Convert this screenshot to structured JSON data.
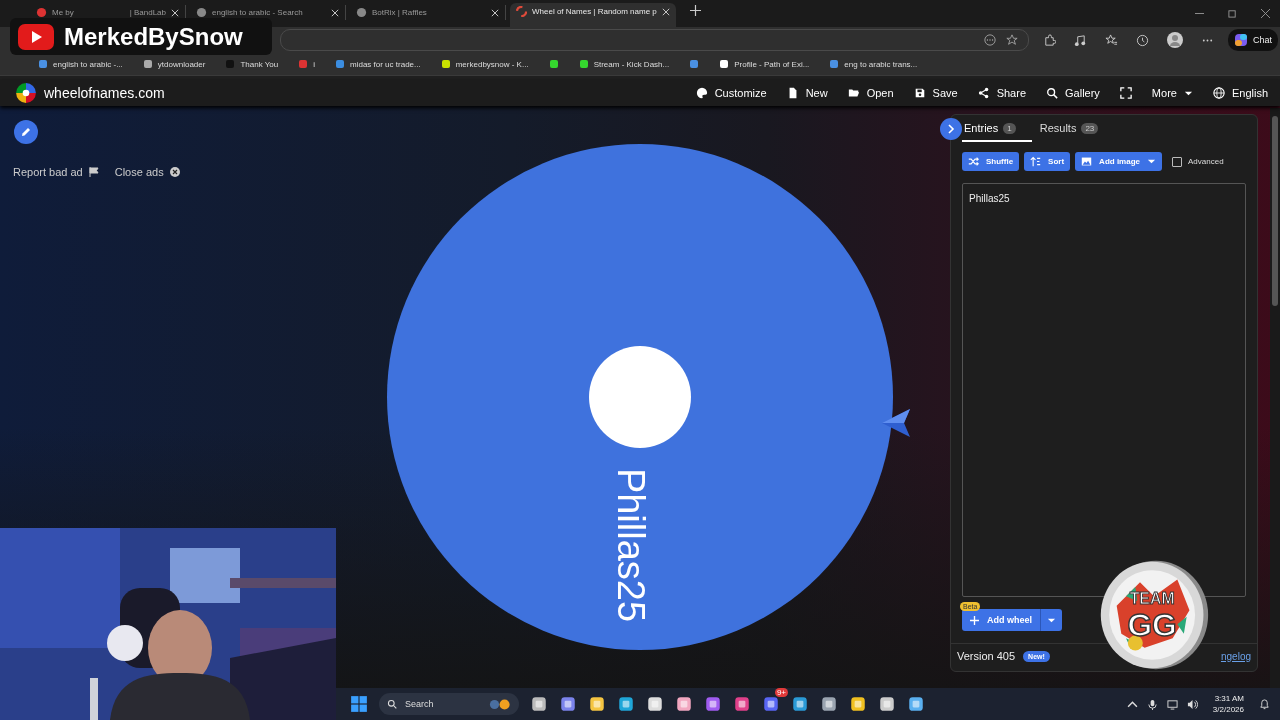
{
  "stream_overlay": {
    "channel": "MerkedBySnow"
  },
  "browser": {
    "tabs": [
      {
        "title": "Me by",
        "title_end": "| BandLab",
        "selected": false
      },
      {
        "title": "english to arabic - Search",
        "selected": false
      },
      {
        "title": "BotRix | Raffles",
        "selected": false
      },
      {
        "title": "Wheel of Names | Random name p",
        "selected": true
      }
    ],
    "bookmarks": [
      {
        "kind": "link",
        "label": "english to arabic -..."
      },
      {
        "kind": "link",
        "label": "ytdownloader"
      },
      {
        "kind": "link",
        "label": "Thank You"
      },
      {
        "kind": "link",
        "label": "i"
      },
      {
        "kind": "link",
        "label": "midas for uc trade..."
      },
      {
        "kind": "link",
        "label": "merkedbysnow - K..."
      },
      {
        "kind": "icon"
      },
      {
        "kind": "link",
        "label": "Stream - Kick Dash..."
      },
      {
        "kind": "icon"
      },
      {
        "kind": "link",
        "label": "Profile - Path of Exi..."
      },
      {
        "kind": "link",
        "label": "eng to arabic trans..."
      }
    ],
    "chat": "Chat"
  },
  "site": {
    "brand": "wheelofnames.com",
    "nav": [
      "Customize",
      "New",
      "Open",
      "Save",
      "Share",
      "Gallery"
    ],
    "more": "More",
    "language": "English"
  },
  "ads": {
    "report": "Report bad ad",
    "close": "Close ads"
  },
  "wheel": {
    "entries": [
      "Phillas25"
    ]
  },
  "panel": {
    "tabs": [
      {
        "label": "Entries",
        "count": "1",
        "selected": true
      },
      {
        "label": "Results",
        "count": "23",
        "selected": false
      }
    ],
    "tools": [
      "Shuffle",
      "Sort",
      "Add image"
    ],
    "advanced": {
      "label": "Advanced",
      "checked": false
    },
    "entries_text": "Phillas25",
    "add_wheel": {
      "label": "Add wheel",
      "badge": "Beta"
    },
    "version": "Version 405",
    "new_badge": "New!",
    "changelog": "ngelog"
  },
  "coin": {
    "top": "TEAM",
    "big": "GG"
  },
  "taskbar": {
    "search": "Search",
    "discord_badge": "9+",
    "time": "3:31 AM",
    "date": "3/2/2026"
  }
}
